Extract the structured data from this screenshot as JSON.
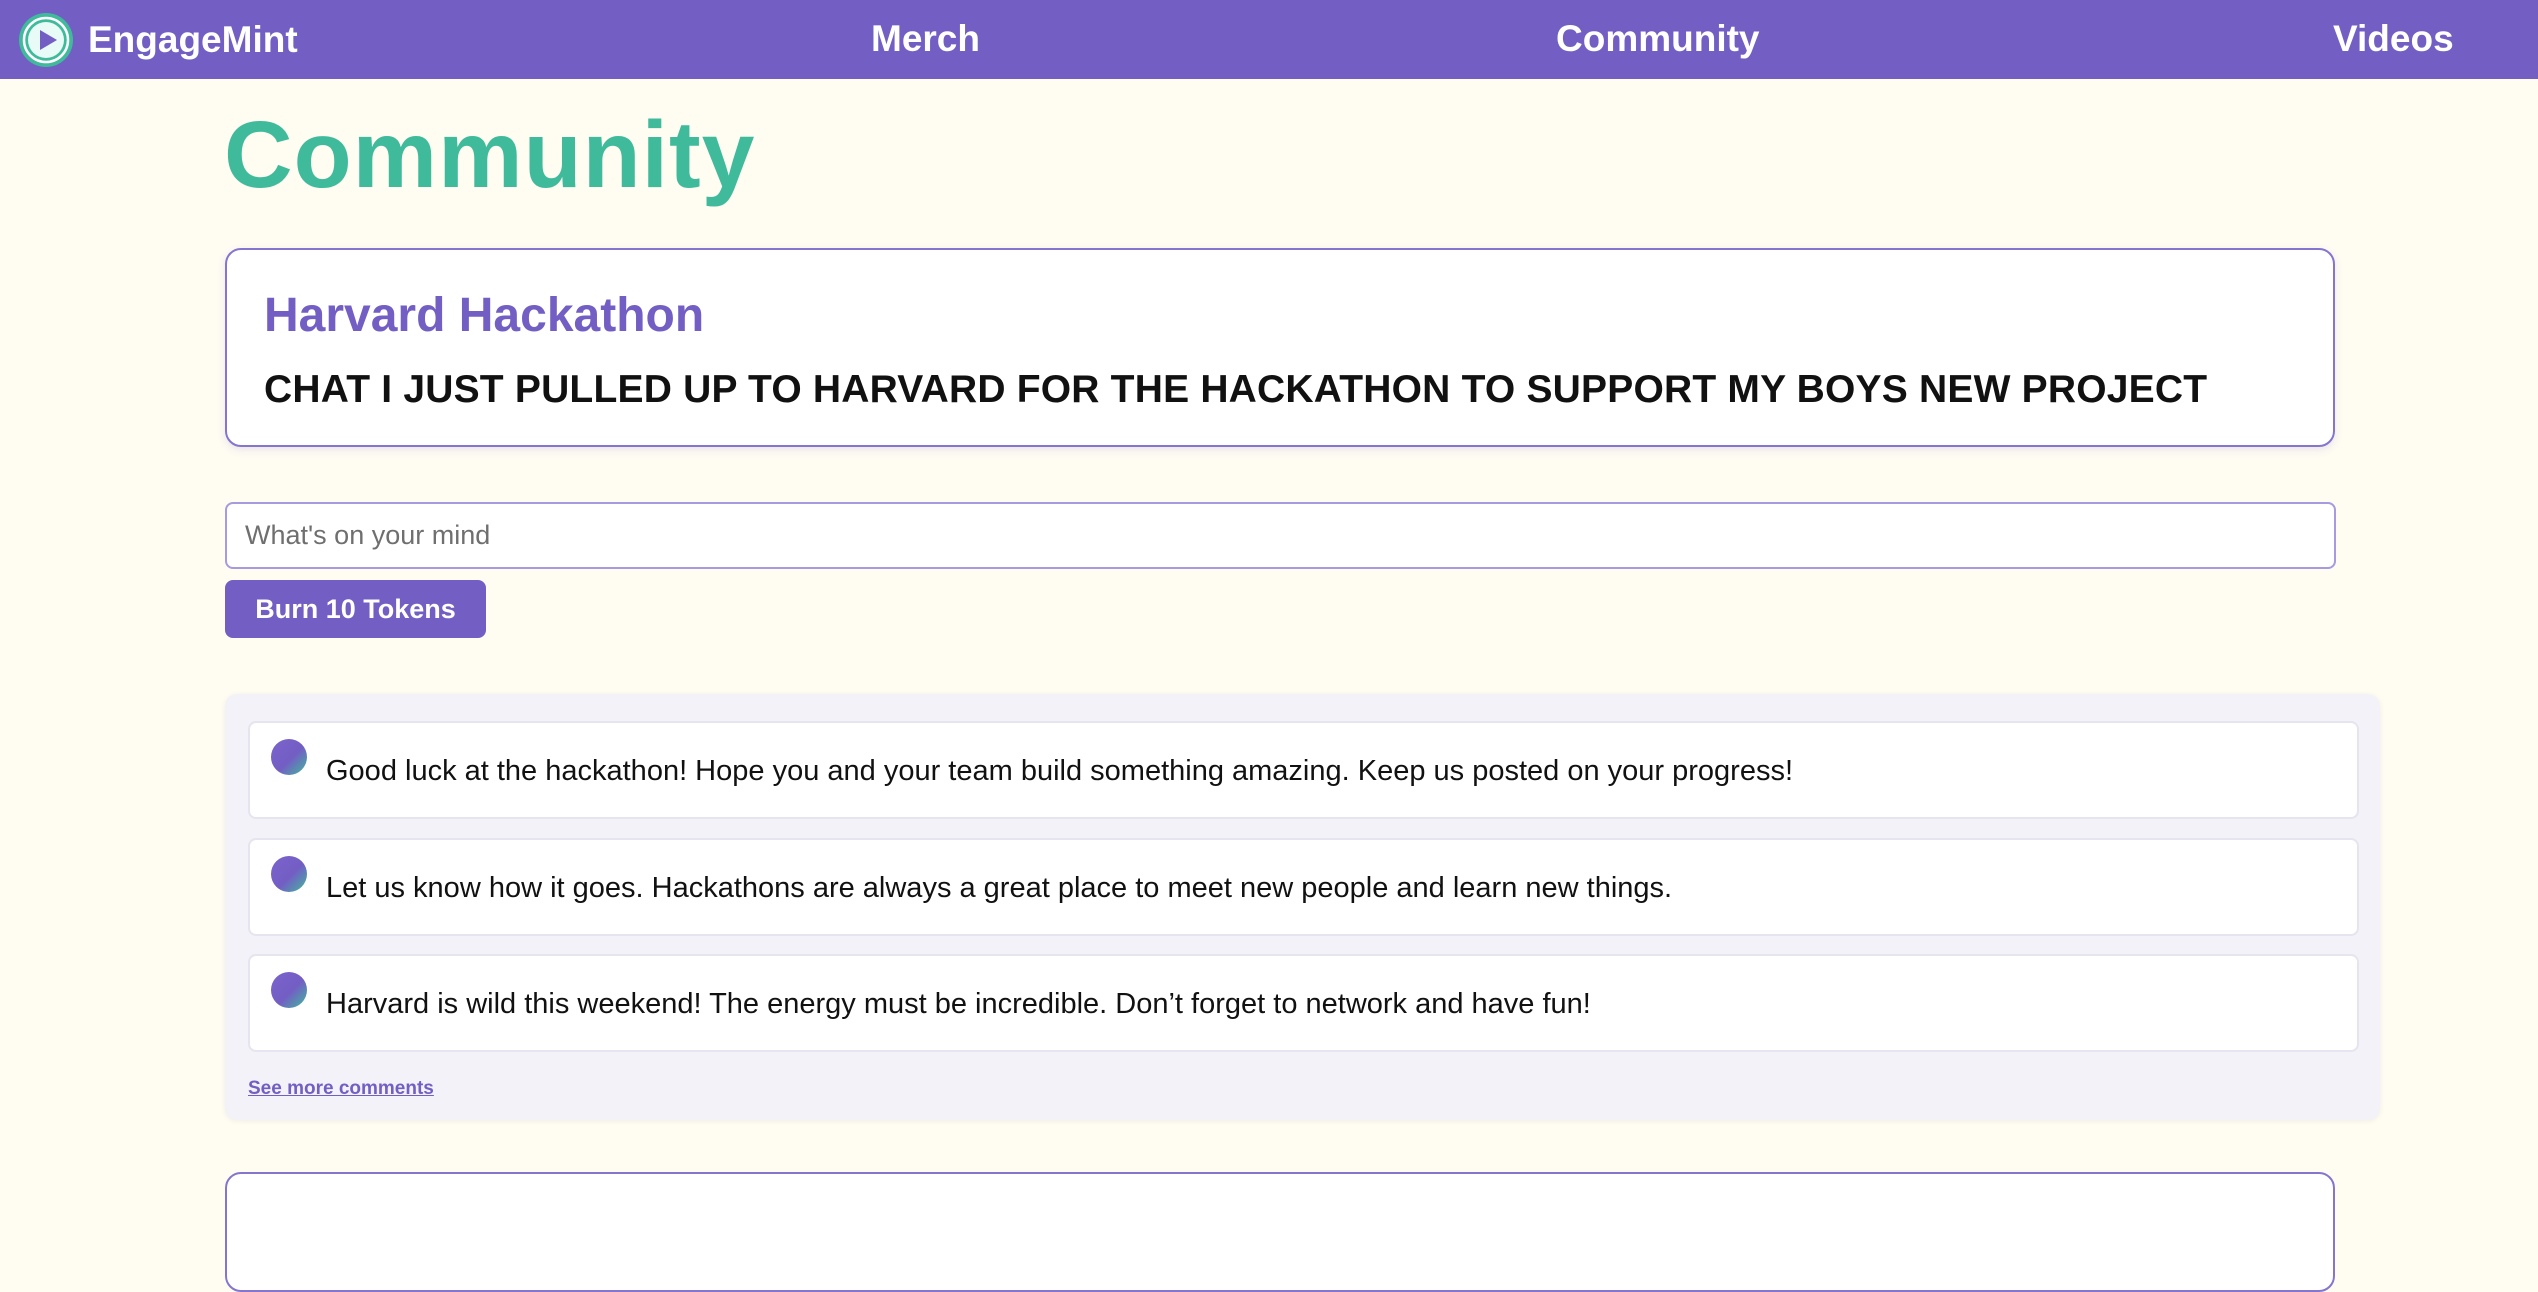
{
  "nav": {
    "brand": "EngageMint",
    "links": [
      "Merch",
      "Community",
      "Videos"
    ]
  },
  "page": {
    "title": "Community"
  },
  "post": {
    "title": "Harvard Hackathon",
    "body": "CHAT I JUST PULLED UP TO HARVARD FOR THE HACKATHON TO SUPPORT MY BOYS NEW PROJECT"
  },
  "composer": {
    "placeholder": "What's on your mind",
    "button_label": "Burn 10 Tokens"
  },
  "comments": {
    "items": [
      "Good luck at the hackathon! Hope you and your team build something amazing. Keep us posted on your progress!",
      "Let us know how it goes. Hackathons are always a great place to meet new people and learn new things.",
      "Harvard is wild this weekend! The energy must be incredible. Don’t forget to network and have fun!"
    ],
    "see_more": "See more comments"
  },
  "colors": {
    "accent": "#735ec4",
    "brand_green": "#3fbb9c",
    "background": "#fffcf2"
  },
  "icons": {
    "logo": "play-icon"
  }
}
